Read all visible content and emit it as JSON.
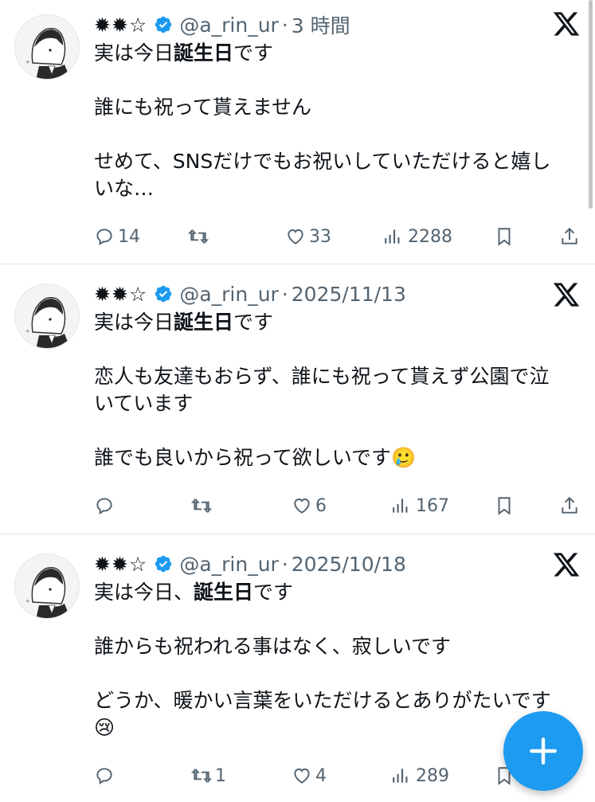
{
  "tweets": [
    {
      "name": "✹✹☆",
      "handle": "@a_rin_ur",
      "separator": "·",
      "time": "3 時間",
      "lines": [
        {
          "pre": "実は今日",
          "bold": "誕生日",
          "post": "です"
        },
        {
          "pre": "",
          "bold": "",
          "post": ""
        },
        {
          "pre": "誰にも祝って貰えません",
          "bold": "",
          "post": ""
        },
        {
          "pre": "",
          "bold": "",
          "post": ""
        },
        {
          "pre": "せめて、SNSだけでもお祝いしていただけると嬉し",
          "bold": "",
          "post": ""
        },
        {
          "pre": "いな…",
          "bold": "",
          "post": ""
        }
      ],
      "stats": {
        "replies": "14",
        "retweets": "",
        "likes": "33",
        "views": "2288"
      }
    },
    {
      "name": "✹✹☆",
      "handle": "@a_rin_ur",
      "separator": "·",
      "time": "2025/11/13",
      "lines": [
        {
          "pre": "実は今日",
          "bold": "誕生日",
          "post": "です"
        },
        {
          "pre": "",
          "bold": "",
          "post": ""
        },
        {
          "pre": "恋人も友達もおらず、誰にも祝って貰えず公園で泣",
          "bold": "",
          "post": ""
        },
        {
          "pre": "いています",
          "bold": "",
          "post": ""
        },
        {
          "pre": "",
          "bold": "",
          "post": ""
        },
        {
          "pre": "誰でも良いから祝って欲しいです🥲",
          "bold": "",
          "post": ""
        }
      ],
      "stats": {
        "replies": "",
        "retweets": "",
        "likes": "6",
        "views": "167"
      }
    },
    {
      "name": "✹✹☆",
      "handle": "@a_rin_ur",
      "separator": "·",
      "time": "2025/10/18",
      "lines": [
        {
          "pre": "実は今日、",
          "bold": "誕生日",
          "post": "です"
        },
        {
          "pre": "",
          "bold": "",
          "post": ""
        },
        {
          "pre": "誰からも祝われる事はなく、寂しいです",
          "bold": "",
          "post": ""
        },
        {
          "pre": "",
          "bold": "",
          "post": ""
        },
        {
          "pre": "どうか、暖かい言葉をいただけるとありがたいです",
          "bold": "",
          "post": ""
        },
        {
          "pre": "😢",
          "bold": "",
          "post": ""
        }
      ],
      "stats": {
        "replies": "",
        "retweets": "1",
        "likes": "4",
        "views": "289"
      }
    }
  ],
  "icons": {
    "verified": "verified-badge-icon",
    "platform": "x-logo-icon",
    "reply": "reply-icon",
    "retweet": "retweet-icon",
    "like": "heart-icon",
    "views": "views-bar-chart-icon",
    "bookmark": "bookmark-icon",
    "share": "share-icon",
    "compose": "plus-icon"
  },
  "colors": {
    "accent": "#1d9bf0",
    "muted": "#536471",
    "text": "#0f1419"
  }
}
